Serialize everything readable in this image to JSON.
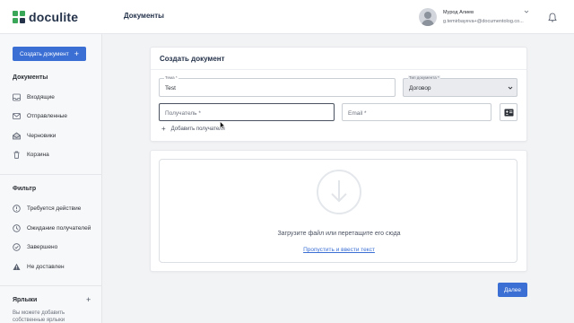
{
  "app": {
    "logo_text": "doculite",
    "brand_color": "#3aa657",
    "accent_color": "#3b6fd4"
  },
  "header": {
    "page_title": "Документы",
    "user_name": "Мурод Алиев",
    "user_email": "g.temirbayeva+@documentolog.co..."
  },
  "sidebar": {
    "create_button": "Создать документ",
    "documents_title": "Документы",
    "documents": [
      {
        "label": "Входящие",
        "icon": "inbox-icon"
      },
      {
        "label": "Отправленные",
        "icon": "sent-mail-icon"
      },
      {
        "label": "Черновики",
        "icon": "drafts-icon"
      },
      {
        "label": "Корзина",
        "icon": "trash-icon"
      }
    ],
    "filter_title": "Фильтр",
    "filters": [
      {
        "label": "Требуется действие",
        "icon": "alert-circle-icon"
      },
      {
        "label": "Ожидание получателей",
        "icon": "clock-icon"
      },
      {
        "label": "Завершено",
        "icon": "check-circle-icon"
      },
      {
        "label": "Не доставлен",
        "icon": "warning-triangle-icon"
      }
    ],
    "labels_title": "Ярлыки",
    "labels_hint": "Вы можете добавить собственные ярлыки"
  },
  "form": {
    "title": "Создать документ",
    "topic_label": "Тема *",
    "topic_value": "Test",
    "doc_type_label": "Тип документа *",
    "doc_type_value": "Договор",
    "recipient_placeholder": "Получатель *",
    "email_placeholder": "Email *",
    "add_recipient": "Добавить получателя"
  },
  "upload": {
    "text": "Загрузите файл или перетащите его сюда",
    "skip_link": "Пропустить и ввести текст"
  },
  "footer": {
    "next_button": "Далее"
  }
}
